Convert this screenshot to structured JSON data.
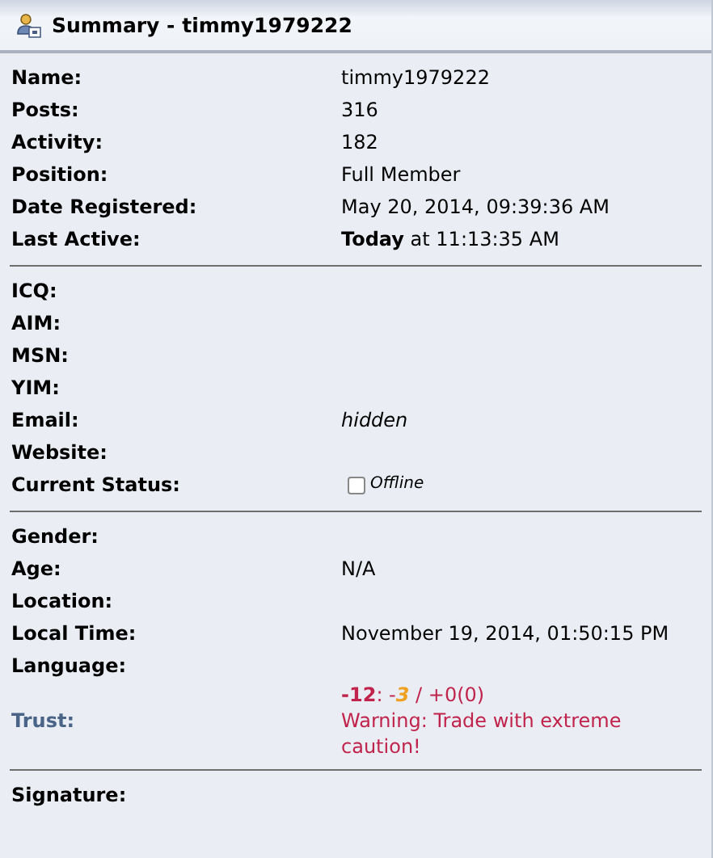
{
  "panel": {
    "title": "Summary - timmy1979222"
  },
  "sections": [
    {
      "rows": [
        {
          "label": "Name:",
          "kind": "text",
          "value": "timmy1979222"
        },
        {
          "label": "Posts:",
          "kind": "text",
          "value": "316"
        },
        {
          "label": "Activity:",
          "kind": "text",
          "value": "182"
        },
        {
          "label": "Position:",
          "kind": "text",
          "value": "Full Member"
        },
        {
          "label": "Date Registered:",
          "kind": "text",
          "value": "May 20, 2014, 09:39:36 AM"
        },
        {
          "label": "Last Active:",
          "kind": "text",
          "value": "**Today** at 11:13:35 AM"
        }
      ]
    },
    {
      "rows": [
        {
          "label": "ICQ:",
          "kind": "text"
        },
        {
          "label": "AIM:",
          "kind": "text"
        },
        {
          "label": "MSN:",
          "kind": "text"
        },
        {
          "label": "YIM:",
          "kind": "text"
        },
        {
          "label": "Email:",
          "kind": "italic",
          "value": "hidden"
        },
        {
          "label": "Website:",
          "kind": "text"
        },
        {
          "label": "Current Status:",
          "kind": "status",
          "value": "Offline"
        }
      ]
    },
    {
      "rows": [
        {
          "label": "Gender:",
          "kind": "text"
        },
        {
          "label": "Age:",
          "kind": "text",
          "value": "N/A"
        },
        {
          "label": "Location:",
          "kind": "text"
        },
        {
          "label": "Local Time:",
          "kind": "text",
          "value": "November 19, 2014, 01:50:15 PM"
        },
        {
          "label": "Language:",
          "kind": "text"
        },
        {
          "label": "Trust:",
          "kind": "trust",
          "link": true,
          "score": "-12",
          "separator": ": -",
          "recent": "3",
          "rest": " / +0(0)",
          "warning": "Warning: Trade with extreme caution!"
        }
      ]
    },
    {
      "rows": [
        {
          "label": "Signature:",
          "kind": "text"
        }
      ]
    }
  ]
}
